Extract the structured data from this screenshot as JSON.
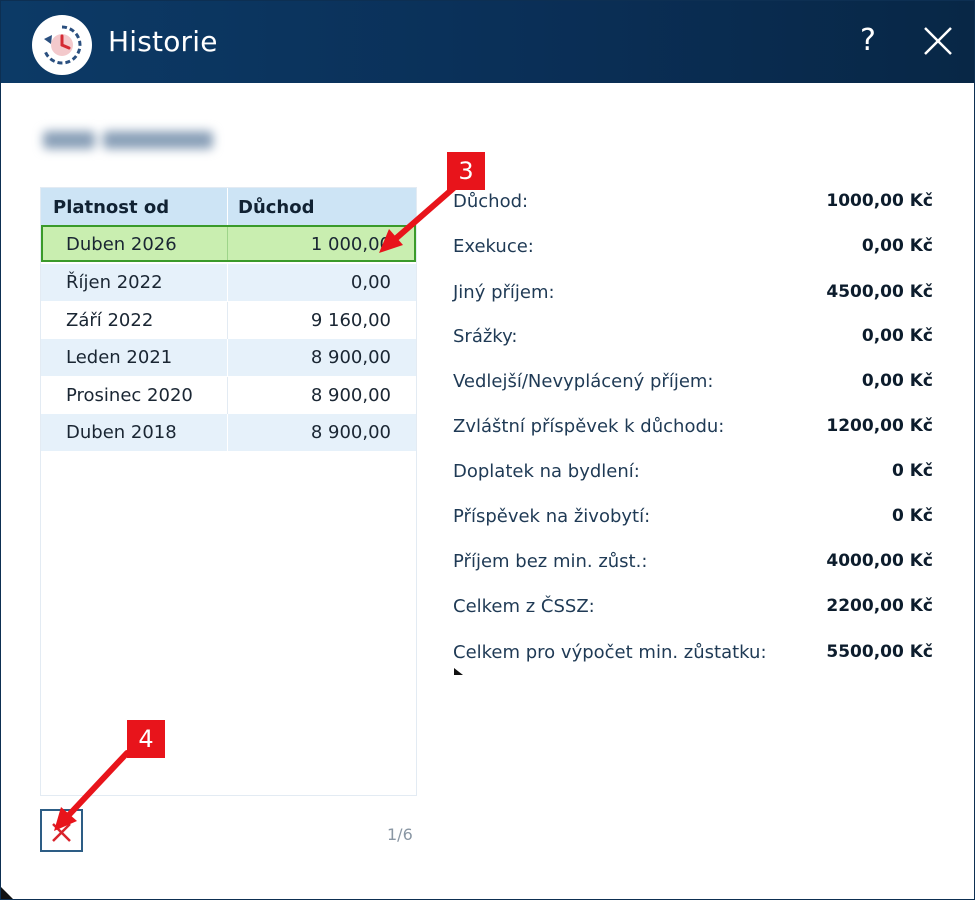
{
  "window": {
    "title": "Historie",
    "help_label": "?",
    "title_icon": "history-clock-icon",
    "close_icon": "close-icon"
  },
  "table": {
    "headers": [
      "Platnost od",
      "Důchod"
    ],
    "rows": [
      {
        "date": "Duben 2026",
        "amount": "1 000,00",
        "selected": true
      },
      {
        "date": "Říjen 2022",
        "amount": "0,00"
      },
      {
        "date": "Září 2022",
        "amount": "9 160,00"
      },
      {
        "date": "Leden 2021",
        "amount": "8 900,00"
      },
      {
        "date": "Prosinec 2020",
        "amount": "8 900,00"
      },
      {
        "date": "Duben 2018",
        "amount": "8 900,00"
      }
    ]
  },
  "pager": "1/6",
  "delete_icon": "delete-x-icon",
  "details": [
    {
      "label": "Důchod:",
      "value": "1000,00 Kč"
    },
    {
      "label": "Exekuce:",
      "value": "0,00 Kč"
    },
    {
      "label": "Jiný příjem:",
      "value": "4500,00 Kč"
    },
    {
      "label": "Srážky:",
      "value": "0,00 Kč"
    },
    {
      "label": "Vedlejší/Nevyplácený příjem:",
      "value": "0,00 Kč"
    },
    {
      "label": "Zvláštní příspěvek k důchodu:",
      "value": "1200,00 Kč"
    },
    {
      "label": "Doplatek na bydlení:",
      "value": "0 Kč"
    },
    {
      "label": "Příspěvek na živobytí:",
      "value": "0 Kč"
    },
    {
      "label": "Příjem bez min. zůst.:",
      "value": "4000,00 Kč"
    },
    {
      "label": "Celkem z ČSSZ:",
      "value": "2200,00 Kč"
    },
    {
      "label": "Celkem pro výpočet min. zůstatku:",
      "value": "5500,00 Kč"
    }
  ],
  "annotations": [
    {
      "number": "3"
    },
    {
      "number": "4"
    }
  ],
  "colors": {
    "titlebar": "#0c3a66",
    "selected_row": "#c9eeb0",
    "selected_border": "#3a9a2a",
    "annotation": "#e8141b"
  }
}
